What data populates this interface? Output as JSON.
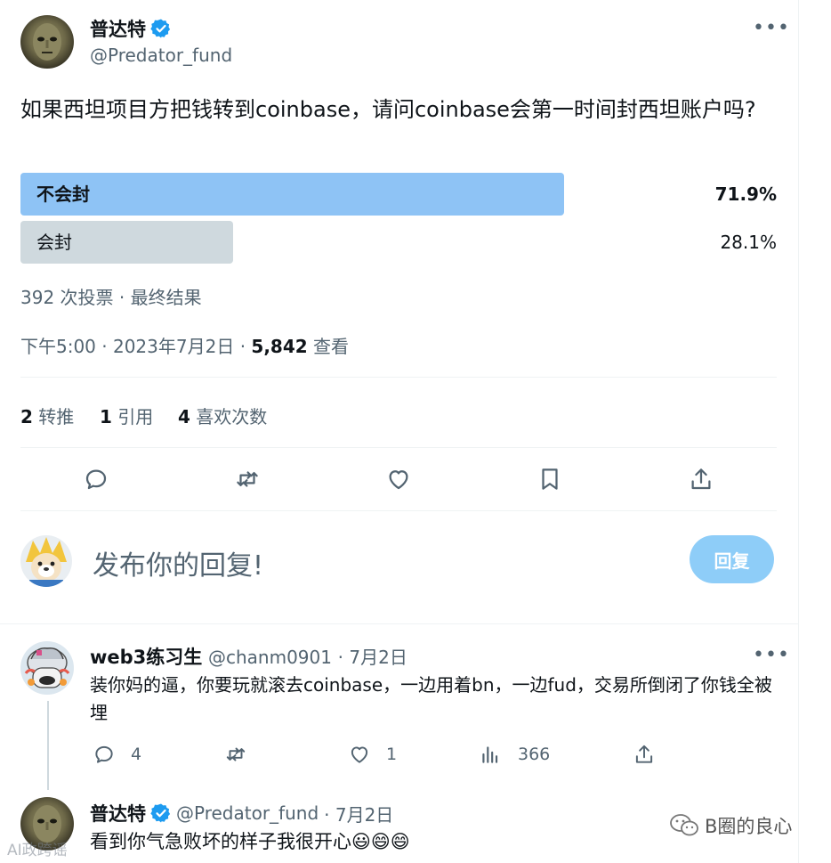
{
  "tweet": {
    "author_name": "普达特",
    "author_handle": "@Predator_fund",
    "text": "如果西坦项目方把钱转到coinbase，请问coinbase会第一时间封西坦账户吗?",
    "poll": {
      "options": [
        {
          "label": "不会封",
          "pct_text": "71.9%",
          "fraction": 0.719,
          "winner": true
        },
        {
          "label": "会封",
          "pct_text": "28.1%",
          "fraction": 0.281,
          "winner": false
        }
      ],
      "summary": "392 次投票 · 最终结果"
    },
    "time": "下午5:00 · 2023年7月2日 ·",
    "views_num": "5,842",
    "views_label": "查看",
    "stats": {
      "retweets_num": "2",
      "retweets_label": "转推",
      "quotes_num": "1",
      "quotes_label": "引用",
      "likes_num": "4",
      "likes_label": "喜欢次数"
    }
  },
  "action_icons": [
    "reply-icon",
    "retweet-icon",
    "like-icon",
    "bookmark-icon",
    "share-icon"
  ],
  "composer": {
    "placeholder": "发布你的回复!",
    "button_label": "回复"
  },
  "replies": [
    {
      "name": "web3练习生",
      "handle": "@chanm0901",
      "date": "· 7月2日",
      "text": "装你妈的逼，你要玩就滚去coinbase，一边用着bn，一边fud，交易所倒闭了你钱全被埋",
      "reply_count": "4",
      "like_count": "1",
      "views_count": "366"
    },
    {
      "name": "普达特",
      "handle": "@Predator_fund",
      "date": "· 7月2日",
      "text": "看到你气急败坏的样子我很开心😃😄😄"
    }
  ],
  "watermark": {
    "left": "AI政跨谣",
    "right": "B圈的良心"
  },
  "colors": {
    "accent": "#1d9bf0",
    "poll_winner": "#8ec3f5",
    "poll_other": "#cfd9de",
    "muted": "#536471",
    "reply_button": "#8ecdf8"
  }
}
